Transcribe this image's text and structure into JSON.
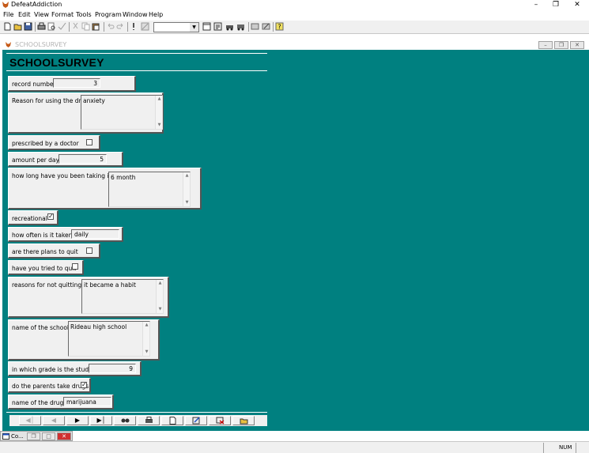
{
  "app": {
    "title": "DefeatAddiction"
  },
  "menu": [
    "File",
    "Edit",
    "View",
    "Format",
    "Tools",
    "Program",
    "Window",
    "Help"
  ],
  "child": {
    "title": "SCHOOLSURVEY"
  },
  "form": {
    "title": "SCHOOLSURVEY",
    "record_number_label": "record number",
    "record_number_value": "3",
    "reason_label": "Reason for using the drug",
    "reason_value": "anxiety",
    "prescribed_label": "prescribed by a doctor",
    "prescribed_checked": false,
    "amount_label": "amount per day",
    "amount_value": "5",
    "how_long_label": "how long have you been taking it",
    "how_long_value": "6 month",
    "recreational_label": "recreational",
    "recreational_checked": true,
    "how_often_label": "how often is it taken",
    "how_often_value": "daily",
    "plans_label": "are there plans to quit",
    "plans_checked": false,
    "tried_label": "have you tried to quit",
    "tried_checked": false,
    "reasons_not_label": "reasons for not quitting",
    "reasons_not_value": "it became a habit",
    "school_label": "name of the school",
    "school_value": "Rideau high school",
    "grade_label": "in which grade is the student",
    "grade_value": "9",
    "parents_label": "do the parents take drugs",
    "parents_checked": true,
    "drugs_label": "name of the drugs",
    "drugs_value": "marijuana"
  },
  "taskbar": {
    "label": "Co..."
  },
  "status": {
    "num": "NUM"
  },
  "colors": {
    "form_bg": "#008080",
    "panel_bg": "#f0f0f0"
  }
}
